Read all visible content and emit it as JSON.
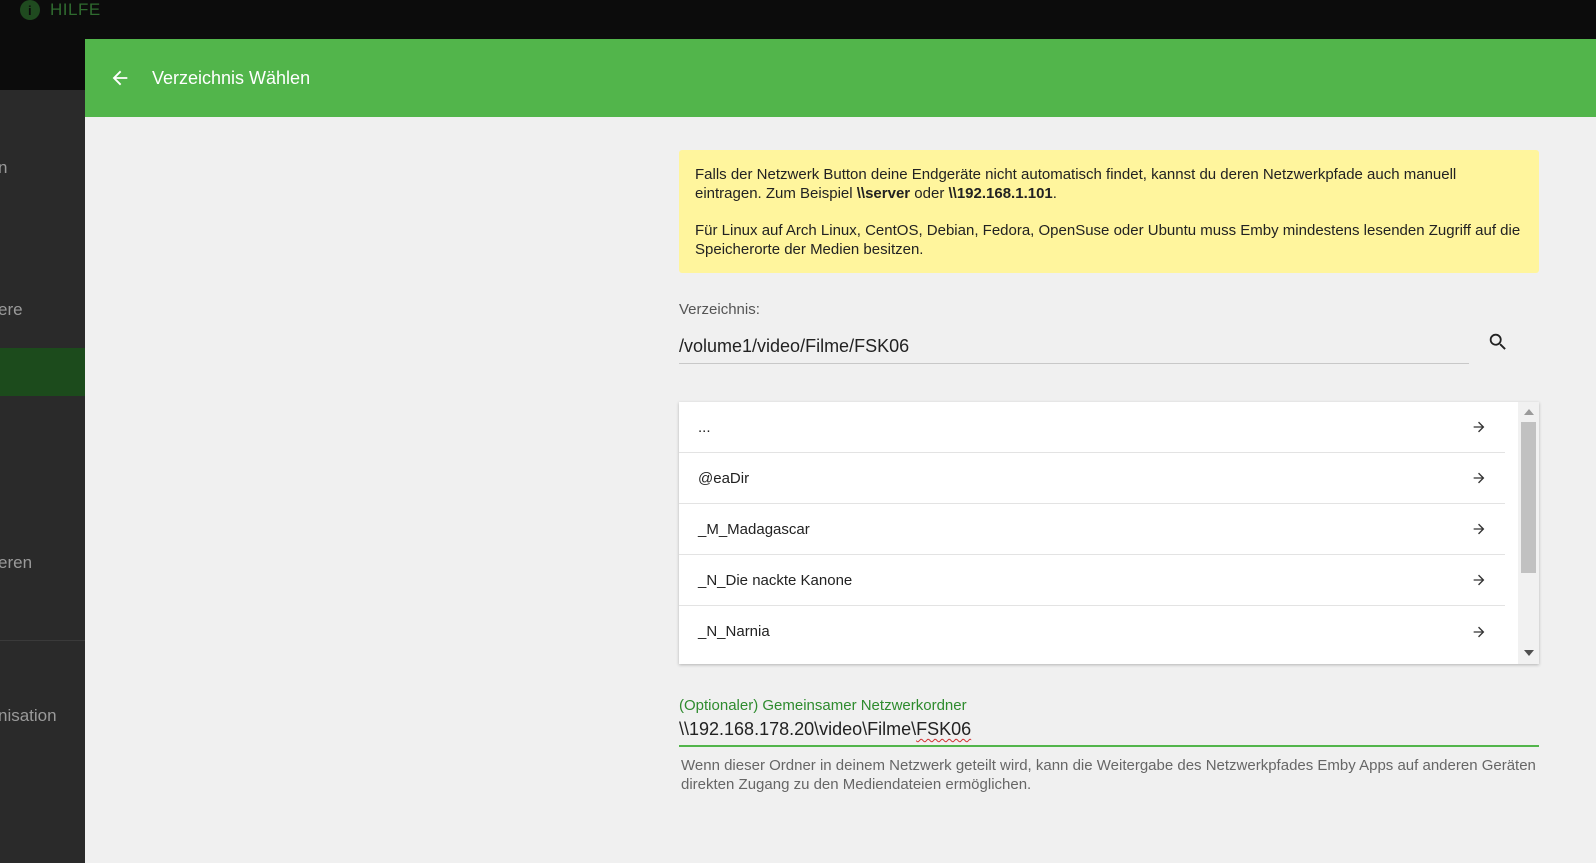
{
  "background": {
    "help_label": "HILFE",
    "sidebar_items": [
      "n",
      "ere",
      "eren",
      "nisation"
    ]
  },
  "dialog": {
    "title": "Verzeichnis Wählen",
    "info": {
      "p1_text": "Falls der Netzwerk Button deine Endgeräte nicht automatisch findet, kannst du deren Netzwerkpfade auch manuell eintragen. Zum Beispiel ",
      "p1_example1": "\\\\server",
      "p1_or": " oder ",
      "p1_example2": "\\\\192.168.1.101",
      "p1_end": ".",
      "p2": "Für Linux auf Arch Linux, CentOS, Debian, Fedora, OpenSuse oder Ubuntu muss Emby mindestens lesenden Zugriff auf die Speicherorte der Medien besitzen."
    },
    "directory": {
      "label": "Verzeichnis:",
      "value": "/volume1/video/Filme/FSK06"
    },
    "folders": [
      {
        "name": "..."
      },
      {
        "name": "@eaDir"
      },
      {
        "name": "_M_Madagascar"
      },
      {
        "name": "_N_Die nackte Kanone"
      },
      {
        "name": "_N_Narnia"
      }
    ],
    "scroll_fraction_visible": 0.68,
    "network_share": {
      "label": "(Optionaler) Gemeinsamer Netzwerkordner",
      "value_prefix": "\\\\192.168.178.20\\video\\Filme\\",
      "value_flagged": "FSK06",
      "help": "Wenn dieser Ordner in deinem Netzwerk geteilt wird, kann die Weitergabe des Netzwerkpfades Emby Apps auf anderen Geräten direkten Zugang zu den Mediendateien ermöglichen."
    }
  },
  "colors": {
    "accent": "#52b54b",
    "info_bg": "#fff59d",
    "dialog_bg": "#f0f0f0"
  },
  "icons": {
    "back": "arrow-left-icon",
    "search": "search-icon",
    "row": "arrow-right-icon"
  }
}
